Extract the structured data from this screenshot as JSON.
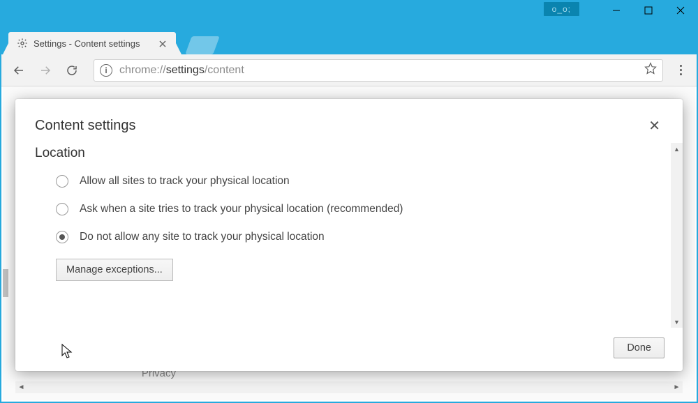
{
  "window": {
    "emoticon": "o_o;",
    "tab_title": "Settings - Content settings"
  },
  "address": {
    "prefix": "chrome://",
    "strong": "settings",
    "suffix": "/content"
  },
  "modal": {
    "title": "Content settings",
    "section_title": "Location",
    "option_allow": "Allow all sites to track your physical location",
    "option_ask": "Ask when a site tries to track your physical location (recommended)",
    "option_deny": "Do not allow any site to track your physical location",
    "manage_exceptions": "Manage exceptions...",
    "done": "Done",
    "selected_index": 2
  },
  "peek_text": "Privacy"
}
